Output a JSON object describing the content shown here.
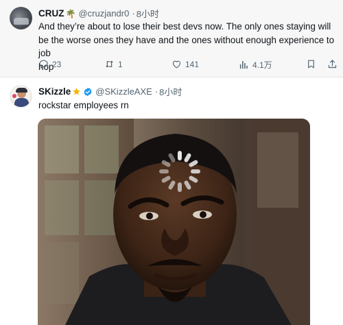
{
  "tweets": [
    {
      "name": "CRUZ",
      "name_emoji": "🌴",
      "handle": "@cruzjandr0",
      "separator": "·",
      "time": "8小时",
      "text_lines": [
        "And they’re about to lose their best devs now. The only ones staying will",
        "be the worse ones they have and the ones without enough experience to job",
        "hop"
      ],
      "replies": "23",
      "retweets": "1",
      "likes": "141",
      "views": "4.1万"
    },
    {
      "name": "SKizzle",
      "handle": "@SKizzleAXE",
      "separator": "·",
      "time": "8小时",
      "text": "rockstar employees rn"
    }
  ],
  "colors": {
    "text": "#0f1419",
    "muted": "#536471",
    "verified": "#1d9bf0",
    "star": "#f4b400",
    "first_tweet_bg": "#f7f7f7"
  },
  "icons": [
    "reply-icon",
    "retweet-icon",
    "like-icon",
    "views-icon",
    "bookmark-icon",
    "share-icon",
    "verified-badge-icon",
    "star-badge-icon",
    "loading-spinner-icon"
  ]
}
